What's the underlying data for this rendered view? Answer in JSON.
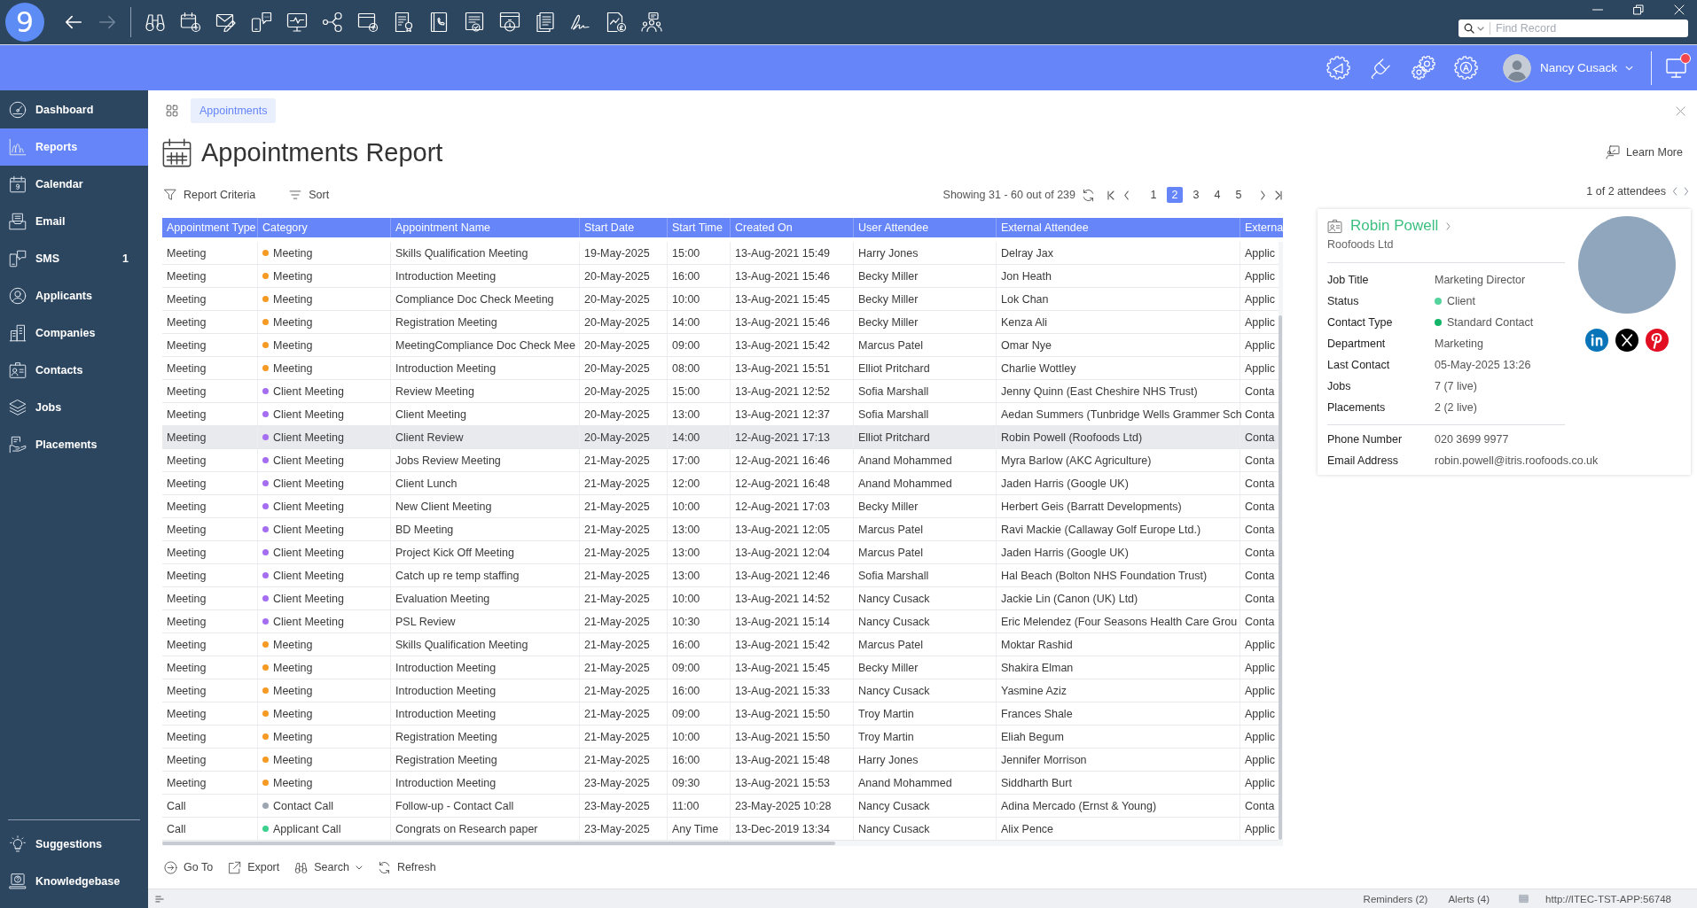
{
  "title_bar": {
    "logo": "9",
    "nav": [
      {
        "disabled": false
      },
      {
        "disabled": true
      }
    ],
    "search": {
      "placeholder": "Find Record"
    }
  },
  "header": {
    "user": "Nancy Cusack",
    "notification": true
  },
  "sidebar": {
    "items": [
      {
        "label": "Dashboard",
        "selected": false
      },
      {
        "label": "Reports",
        "selected": true
      },
      {
        "label": "Calendar",
        "selected": false
      },
      {
        "label": "Email",
        "selected": false
      },
      {
        "label": "SMS",
        "selected": false,
        "badge": "1"
      },
      {
        "label": "Applicants",
        "selected": false
      },
      {
        "label": "Companies",
        "selected": false
      },
      {
        "label": "Contacts",
        "selected": false
      },
      {
        "label": "Jobs",
        "selected": false
      },
      {
        "label": "Placements",
        "selected": false
      }
    ],
    "footer_items": [
      {
        "label": "Suggestions"
      },
      {
        "label": "Knowledgebase"
      }
    ]
  },
  "tabs": [
    {
      "label": "Appointments",
      "selected": true
    }
  ],
  "page": {
    "title": "Appointments Report",
    "learn_more": "Learn More"
  },
  "toolbar": {
    "actions": [
      {
        "label": "Report Criteria"
      },
      {
        "label": "Sort"
      }
    ]
  },
  "pagination": {
    "summary": "Showing 31 - 60 out of 239",
    "pages": [
      {
        "label": "1",
        "selected": false
      },
      {
        "label": "2",
        "selected": true
      },
      {
        "label": "3",
        "selected": false
      },
      {
        "label": "4",
        "selected": false
      },
      {
        "label": "5",
        "selected": false
      }
    ]
  },
  "table": {
    "columns": [
      "Appointment Type",
      "Category",
      "Appointment Name",
      "Start Date",
      "Start Time",
      "Created On",
      "User Attendee",
      "External Attendee",
      "Externa"
    ],
    "rows": [
      {
        "cells": [
          "Meeting",
          "Meeting",
          "Skills Qualification Meeting",
          "19-May-2025",
          "15:00",
          "13-Aug-2021 15:49",
          "Harry Jones",
          "Delray Jax",
          "Applic"
        ],
        "color": "#f59a23",
        "selected": false
      },
      {
        "cells": [
          "Meeting",
          "Meeting",
          "Introduction Meeting",
          "20-May-2025",
          "16:00",
          "13-Aug-2021 15:46",
          "Becky Miller",
          "Jon Heath",
          "Applic"
        ],
        "color": "#f59a23",
        "selected": false
      },
      {
        "cells": [
          "Meeting",
          "Meeting",
          "Compliance Doc Check Meeting",
          "20-May-2025",
          "10:00",
          "13-Aug-2021 15:45",
          "Becky Miller",
          "Lok Chan",
          "Applic"
        ],
        "color": "#f59a23",
        "selected": false
      },
      {
        "cells": [
          "Meeting",
          "Meeting",
          "Registration Meeting",
          "20-May-2025",
          "14:00",
          "13-Aug-2021 15:46",
          "Becky Miller",
          "Kenza Ali",
          "Applic"
        ],
        "color": "#f59a23",
        "selected": false
      },
      {
        "cells": [
          "Meeting",
          "Meeting",
          "MeetingCompliance Doc Check Mee",
          "20-May-2025",
          "09:00",
          "13-Aug-2021 15:42",
          "Marcus Patel",
          "Omar Nye",
          "Applic"
        ],
        "color": "#f59a23",
        "selected": false
      },
      {
        "cells": [
          "Meeting",
          "Meeting",
          "Introduction Meeting",
          "20-May-2025",
          "08:00",
          "13-Aug-2021 15:51",
          "Elliot Pritchard",
          "Charlie Wottley",
          "Applic"
        ],
        "color": "#f59a23",
        "selected": false
      },
      {
        "cells": [
          "Meeting",
          "Client Meeting",
          "Review Meeting",
          "20-May-2025",
          "15:00",
          "13-Aug-2021 12:52",
          "Sofia Marshall",
          "Jenny Quinn (East Cheshire NHS Trust)",
          "Conta"
        ],
        "color": "#a56ef0",
        "selected": false
      },
      {
        "cells": [
          "Meeting",
          "Client Meeting",
          "Client Meeting",
          "20-May-2025",
          "13:00",
          "13-Aug-2021 12:37",
          "Sofia Marshall",
          "Aedan Summers (Tunbridge Wells Grammer Sch",
          "Conta"
        ],
        "color": "#a56ef0",
        "selected": false
      },
      {
        "cells": [
          "Meeting",
          "Client Meeting",
          "Client Review",
          "20-May-2025",
          "14:00",
          "12-Aug-2021 17:13",
          "Elliot Pritchard",
          "Robin Powell (Roofoods Ltd)",
          "Conta"
        ],
        "color": "#a56ef0",
        "selected": true
      },
      {
        "cells": [
          "Meeting",
          "Client Meeting",
          "Jobs Review Meeting",
          "21-May-2025",
          "17:00",
          "12-Aug-2021 16:46",
          "Anand Mohammed",
          "Myra Barlow (AKC Agriculture)",
          "Conta"
        ],
        "color": "#a56ef0",
        "selected": false
      },
      {
        "cells": [
          "Meeting",
          "Client Meeting",
          "Client Lunch",
          "21-May-2025",
          "12:00",
          "12-Aug-2021 16:48",
          "Anand Mohammed",
          "Jaden Harris (Google UK)",
          "Conta"
        ],
        "color": "#a56ef0",
        "selected": false
      },
      {
        "cells": [
          "Meeting",
          "Client Meeting",
          "New Client Meeting",
          "21-May-2025",
          "10:00",
          "12-Aug-2021 17:03",
          "Becky Miller",
          "Herbert Geis (Barratt Developments)",
          "Conta"
        ],
        "color": "#a56ef0",
        "selected": false
      },
      {
        "cells": [
          "Meeting",
          "Client Meeting",
          "BD Meeting",
          "21-May-2025",
          "13:00",
          "13-Aug-2021 12:05",
          "Marcus Patel",
          "Ravi Mackie (Callaway Golf Europe Ltd.)",
          "Conta"
        ],
        "color": "#a56ef0",
        "selected": false
      },
      {
        "cells": [
          "Meeting",
          "Client Meeting",
          "Project Kick Off Meeting",
          "21-May-2025",
          "13:00",
          "13-Aug-2021 12:04",
          "Marcus Patel",
          "Jaden Harris (Google UK)",
          "Conta"
        ],
        "color": "#a56ef0",
        "selected": false
      },
      {
        "cells": [
          "Meeting",
          "Client Meeting",
          "Catch up re temp staffing",
          "21-May-2025",
          "13:00",
          "13-Aug-2021 12:46",
          "Sofia Marshall",
          "Hal Beach (Bolton NHS Foundation Trust)",
          "Conta"
        ],
        "color": "#a56ef0",
        "selected": false
      },
      {
        "cells": [
          "Meeting",
          "Client Meeting",
          "Evaluation Meeting",
          "21-May-2025",
          "10:00",
          "13-Aug-2021 14:52",
          "Nancy Cusack",
          "Jackie Lin (Canon (UK) Ltd)",
          "Conta"
        ],
        "color": "#a56ef0",
        "selected": false
      },
      {
        "cells": [
          "Meeting",
          "Client Meeting",
          "PSL Review",
          "21-May-2025",
          "10:30",
          "13-Aug-2021 15:14",
          "Nancy Cusack",
          "Eric Melendez (Four Seasons Health Care Grou",
          "Conta"
        ],
        "color": "#a56ef0",
        "selected": false
      },
      {
        "cells": [
          "Meeting",
          "Meeting",
          "Skills Qualification Meeting",
          "21-May-2025",
          "16:00",
          "13-Aug-2021 15:42",
          "Marcus Patel",
          "Moktar Rashid",
          "Applic"
        ],
        "color": "#f59a23",
        "selected": false
      },
      {
        "cells": [
          "Meeting",
          "Meeting",
          "Introduction Meeting",
          "21-May-2025",
          "09:00",
          "13-Aug-2021 15:45",
          "Becky Miller",
          "Shakira Elman",
          "Applic"
        ],
        "color": "#f59a23",
        "selected": false
      },
      {
        "cells": [
          "Meeting",
          "Meeting",
          "Introduction Meeting",
          "21-May-2025",
          "16:00",
          "13-Aug-2021 15:33",
          "Nancy Cusack",
          "Yasmine Aziz",
          "Applic"
        ],
        "color": "#f59a23",
        "selected": false
      },
      {
        "cells": [
          "Meeting",
          "Meeting",
          "Introduction Meeting",
          "21-May-2025",
          "09:00",
          "13-Aug-2021 15:50",
          "Troy Martin",
          "Frances Shale",
          "Applic"
        ],
        "color": "#f59a23",
        "selected": false
      },
      {
        "cells": [
          "Meeting",
          "Meeting",
          "Registration Meeting",
          "21-May-2025",
          "10:00",
          "13-Aug-2021 15:50",
          "Troy Martin",
          "Eliah Begum",
          "Applic"
        ],
        "color": "#f59a23",
        "selected": false
      },
      {
        "cells": [
          "Meeting",
          "Meeting",
          "Registration Meeting",
          "21-May-2025",
          "16:00",
          "13-Aug-2021 15:48",
          "Harry Jones",
          "Jennifer Morrison",
          "Applic"
        ],
        "color": "#f59a23",
        "selected": false
      },
      {
        "cells": [
          "Meeting",
          "Meeting",
          "Introduction Meeting",
          "23-May-2025",
          "09:30",
          "13-Aug-2021 15:53",
          "Anand Mohammed",
          "Siddharth Burt",
          "Applic"
        ],
        "color": "#f59a23",
        "selected": false
      },
      {
        "cells": [
          "Call",
          "Contact Call",
          "Follow-up - Contact Call",
          "23-May-2025",
          "11:00",
          "23-May-2025 10:28",
          "Nancy Cusack",
          "Adina Mercado (Ernst & Young)",
          "Conta"
        ],
        "color": "#9ca6b3",
        "selected": false
      },
      {
        "cells": [
          "Call",
          "Applicant Call",
          "Congrats on Research paper",
          "23-May-2025",
          "Any Time",
          "13-Dec-2019 13:34",
          "Nancy Cusack",
          "Alix Pence",
          "Applic"
        ],
        "color": "#3ccf8e",
        "selected": false
      }
    ]
  },
  "bottom_toolbar": [
    {
      "label": "Go To",
      "dropdown": false
    },
    {
      "label": "Export",
      "dropdown": false
    },
    {
      "label": "Search",
      "dropdown": true
    },
    {
      "label": "Refresh",
      "dropdown": false
    }
  ],
  "attendee_panel": {
    "counter": "1 of 2 attendees",
    "contact": {
      "name": "Robin Powell",
      "company": "Roofoods Ltd",
      "details": [
        {
          "label": "Job Title",
          "value": "Marketing Director"
        },
        {
          "label": "Status",
          "value": "Client",
          "color": "#55d39c"
        },
        {
          "label": "Contact Type",
          "value": "Standard Contact",
          "color": "#14b56a"
        },
        {
          "label": "Department",
          "value": "Marketing"
        },
        {
          "label": "Last Contact",
          "value": "05-May-2025 13:26"
        },
        {
          "label": "Jobs",
          "value": "7 (7 live)"
        },
        {
          "label": "Placements",
          "value": "2 (2 live)"
        }
      ],
      "contact_details": [
        {
          "label": "Phone Number",
          "value": "020 3699 9977"
        },
        {
          "label": "Email Address",
          "value": "robin.powell@itris.roofoods.co.uk"
        }
      ]
    }
  },
  "status_bar": {
    "reminders": "Reminders (2)",
    "alerts": "Alerts (4)",
    "server": "http://ITEC-TST-APP:56748"
  }
}
